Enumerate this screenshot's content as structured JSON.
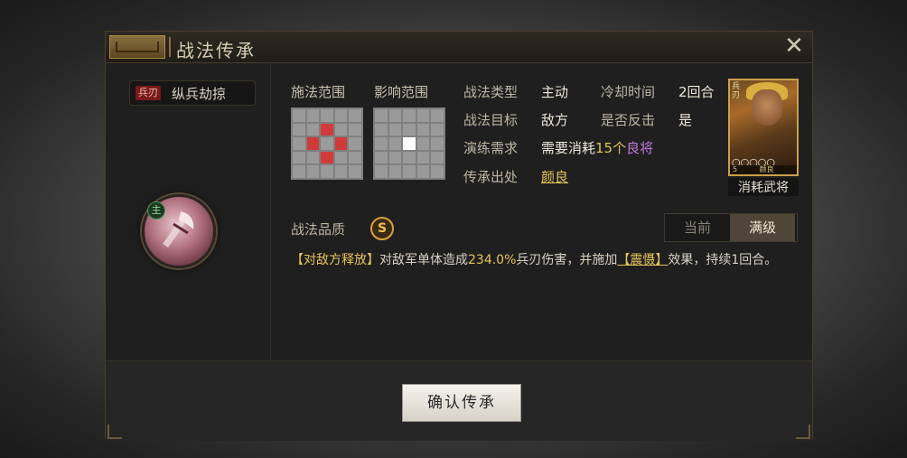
{
  "dialog": {
    "title": "战法传承",
    "close_icon": "close-icon"
  },
  "skill": {
    "type_badge": "兵刃",
    "name": "纵兵劫掠",
    "main_badge": "主",
    "icon": "battle-axe-icon"
  },
  "ranges": {
    "cast_label": "施法范围",
    "effect_label": "影响范围"
  },
  "info": {
    "skill_type_label": "战法类型",
    "skill_type_value": "主动",
    "cooldown_label": "冷却时间",
    "cooldown_value": "2回合",
    "target_label": "战法目标",
    "target_value": "敌方",
    "counter_label": "是否反击",
    "counter_value": "是",
    "drill_label": "演练需求",
    "drill_prefix": "需要消耗",
    "drill_count": "15个",
    "drill_item": "良将",
    "source_label": "传承出处",
    "source_value": "颜良"
  },
  "general_card": {
    "stars": "○○○○○",
    "tag": "兵刃",
    "footer_left": "5",
    "footer_right": "颜良",
    "caption": "消耗武将"
  },
  "quality": {
    "label": "战法品质",
    "grade": "S"
  },
  "toggle": {
    "current": "当前",
    "max": "满级"
  },
  "description": {
    "trigger": "【对敌方释放】",
    "text1": "对敌军单体造成",
    "damage": "234.0%",
    "text2": "兵刃伤害，并施加",
    "status": "【震慑】",
    "text3": "效果，持续1回合。"
  },
  "footer": {
    "confirm_label": "确认传承"
  },
  "colors": {
    "accent_gold": "#e6c45a",
    "purple": "#c67be0",
    "range_red": "#d23a3a"
  }
}
